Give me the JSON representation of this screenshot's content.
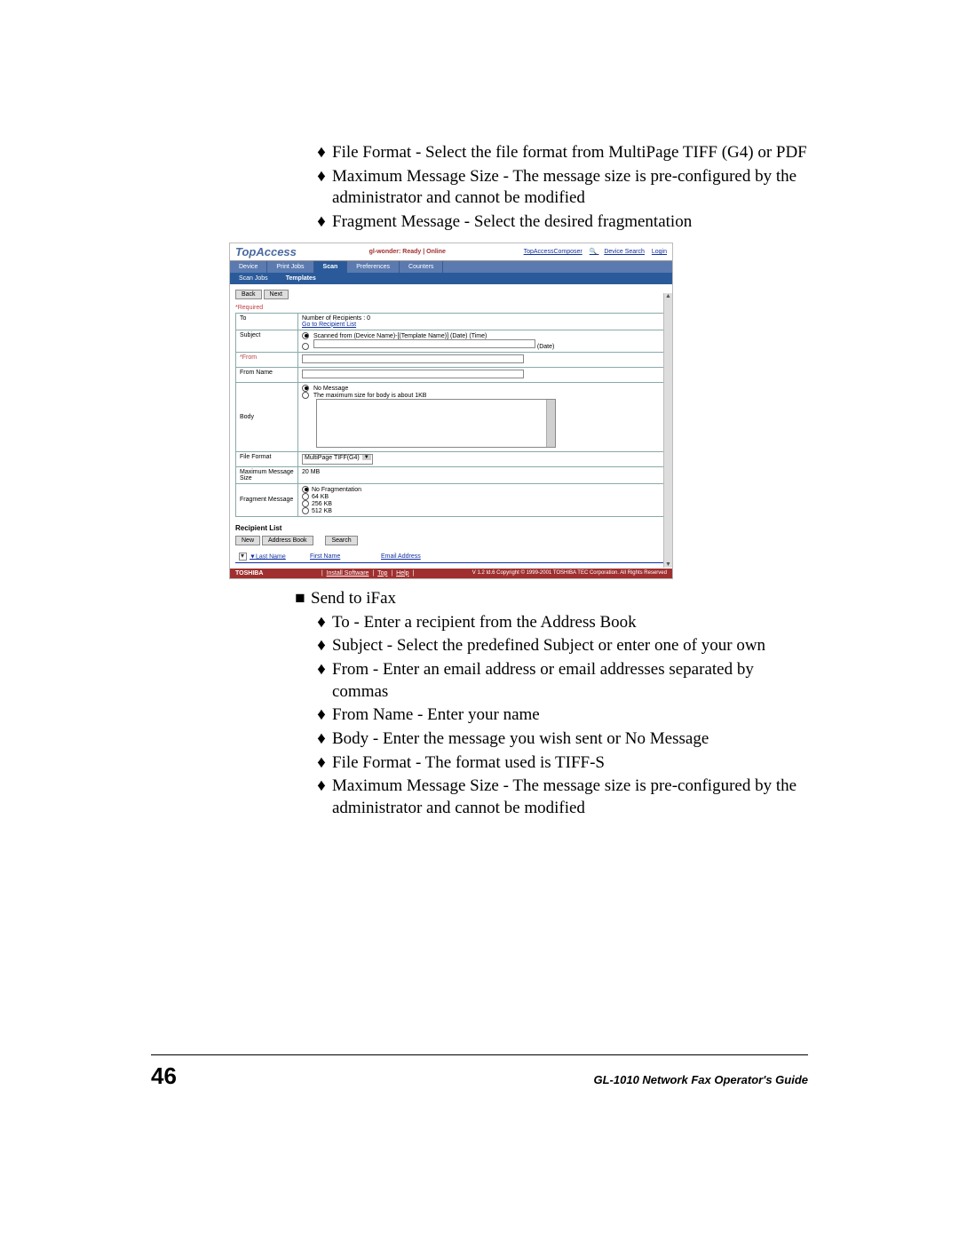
{
  "bullets_top": [
    "File Format - Select the file format from MultiPage TIFF (G4) or PDF",
    "Maximum Message Size - The message size is pre-configured by the administrator and cannot be modified",
    "Fragment Message - Select the desired fragmentation"
  ],
  "section2_header": "Send to iFax",
  "bullets_bottom": [
    "To - Enter a recipient from the Address Book",
    "Subject - Select the predefined Subject or enter one of your own",
    "From - Enter an email address or email addresses separated by commas",
    "From Name - Enter your name",
    "Body - Enter the message you wish sent or No Message",
    "File Format - The format used is TIFF-S",
    "Maximum Message Size - The message size is pre-configured by the administrator and cannot be modified"
  ],
  "footer": {
    "page_number": "46",
    "title": "GL-1010 Network Fax Operator's Guide"
  },
  "shot": {
    "app_logo": "TopAccess",
    "status": "gl-wonder: Ready | Online",
    "top_links": {
      "composer": "TopAccessComposer",
      "device_search": "Device Search",
      "login": "Login"
    },
    "tabs1": [
      "Device",
      "Print Jobs",
      "Scan",
      "Preferences",
      "Counters"
    ],
    "tabs2": [
      "Scan Jobs",
      "Templates"
    ],
    "btn_back": "Back",
    "btn_next": "Next",
    "required_label": "*Required",
    "rows": {
      "to": {
        "label": "To",
        "recip_count": "Number of Recipients : 0",
        "go_link": "Go to Recipient List"
      },
      "subject": {
        "label": "Subject",
        "radio_text": "Scanned from (Device Name)-[(Template Name)] (Date) (Time)",
        "date_hint": "(Date)"
      },
      "from": {
        "label": "*From"
      },
      "from_name": {
        "label": "From Name"
      },
      "body": {
        "label": "Body",
        "opt1": "No Message",
        "opt2": "The maximum size for body is about 1KB"
      },
      "file_format": {
        "label": "File Format",
        "value": "MultiPage TIFF(G4)"
      },
      "max_size": {
        "label": "Maximum Message Size",
        "value": "20 MB"
      },
      "fragment": {
        "label": "Fragment Message",
        "opts": [
          "No Fragmentation",
          "64 KB",
          "256 KB",
          "512 KB"
        ]
      }
    },
    "recipient_list": {
      "title": "Recipient List",
      "btn_new": "New",
      "btn_addr": "Address Book",
      "btn_search": "Search",
      "cols": [
        "Last Name",
        "First Name",
        "Email Address"
      ]
    },
    "footer": {
      "brand": "TOSHIBA",
      "links": [
        "Install Software",
        "Top",
        "Help"
      ],
      "copyright": "V 1.2 td.6  Copyright © 1999-2001 TOSHIBA TEC Corporation. All Rights Reserved"
    }
  }
}
